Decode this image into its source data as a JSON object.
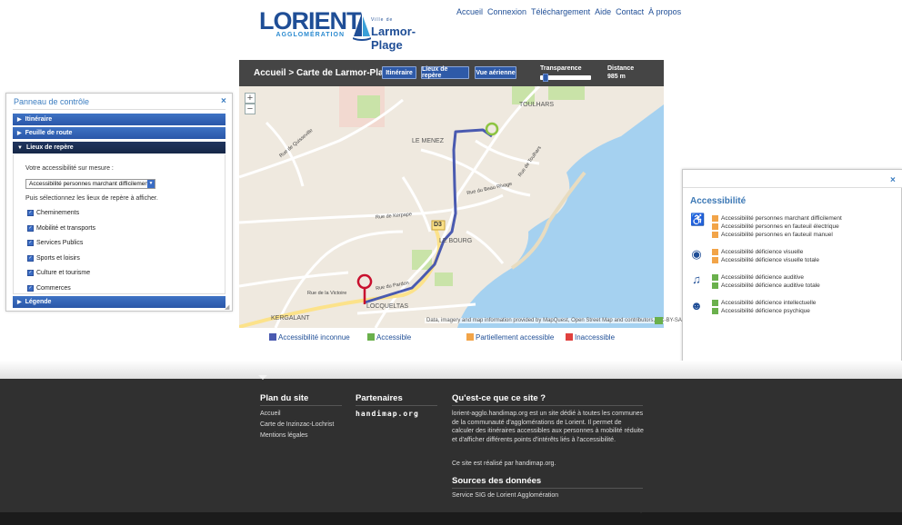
{
  "header": {
    "logo_lorient": {
      "word": "LORIENT",
      "sub": "AGGLOMÉRATION"
    },
    "logo_larmor": {
      "ville": "Ville de",
      "word": "Larmor-Plage"
    },
    "nav": [
      "Accueil",
      "Connexion",
      "Téléchargement",
      "Aide",
      "Contact",
      "À propos"
    ]
  },
  "toolbar": {
    "breadcrumb": "Accueil > Carte de Larmor-Plage",
    "buttons": [
      "Itinéraire",
      "Lieux de repère",
      "Vue aérienne"
    ],
    "transparence_label": "Transparence",
    "transparence_value": 0.05,
    "distance_label": "Distance",
    "distance_value": "985 m"
  },
  "map": {
    "zoom_in": "+",
    "zoom_out": "−",
    "labels": {
      "toulhars": "TOULHARS",
      "le_menez": "LE MENEZ",
      "le_bourg": "LE BOURG",
      "locqueltas": "LOCQUELTAS",
      "kergalant": "KERGALANT",
      "d3": "D3",
      "rue_kerpape": "Rue de Kerpape",
      "rue_beau_rivage": "Rue du Beau Rivage",
      "rue_quisseville": "Rue de Quisseville",
      "rue_victoire": "Rue de la Victoire",
      "rue_pardon": "Rue du Pardon",
      "rue_tourlhers": "Rue de Toulhars"
    },
    "attribution": "Data, imagery and map information provided by MapQuest, Open Street Map and contributors, CC-BY-SA"
  },
  "legend": [
    {
      "label": "Accessibilité inconnue",
      "color": "#4a5ab0"
    },
    {
      "label": "Accessible",
      "color": "#6ab04c"
    },
    {
      "label": "Partiellement accessible",
      "color": "#f2a448"
    },
    {
      "label": "Inaccessible",
      "color": "#e0413e"
    }
  ],
  "control_panel": {
    "title": "Panneau de contrôle",
    "close": "×",
    "sections": [
      "Itinéraire",
      "Feuille de route",
      "Lieux de repère",
      "Légende"
    ],
    "accessibility_label": "Votre accessibilité sur mesure :",
    "accessibility_selected": "Accessibilité personnes marchant difficilement",
    "instruction": "Puis sélectionnez les lieux de repère à afficher.",
    "checkboxes": [
      "Cheminements",
      "Mobilité et transports",
      "Services Publics",
      "Sports et loisirs",
      "Culture et tourisme",
      "Commerces"
    ],
    "check_mark": "✓",
    "arrow_right": "▶",
    "arrow_down": "▼",
    "select_arrow": "▼"
  },
  "accessibility_panel": {
    "title": "Accessibilité",
    "close": "×",
    "groups": [
      {
        "icon": "wheelchair-icon",
        "glyph": "♿",
        "items": [
          {
            "label": "Accessibilité personnes marchant difficilement",
            "color": "#f2a448"
          },
          {
            "label": "Accessibilité personnes en fauteuil électrique",
            "color": "#f2a448"
          },
          {
            "label": "Accessibilité personnes en fauteuil manuel",
            "color": "#f2a448"
          }
        ]
      },
      {
        "icon": "eye-icon",
        "glyph": "◉",
        "items": [
          {
            "label": "Accessibilité déficience visuelle",
            "color": "#f2a448"
          },
          {
            "label": "Accessibilité déficience visuelle totale",
            "color": "#f2a448"
          }
        ]
      },
      {
        "icon": "ear-icon",
        "glyph": "♫",
        "items": [
          {
            "label": "Accessibilité déficience auditive",
            "color": "#6ab04c"
          },
          {
            "label": "Accessibilité déficience auditive totale",
            "color": "#6ab04c"
          }
        ]
      },
      {
        "icon": "mind-icon",
        "glyph": "☻",
        "items": [
          {
            "label": "Accessibilité déficience intellectuelle",
            "color": "#6ab04c"
          },
          {
            "label": "Accessibilité déficience psychique",
            "color": "#6ab04c"
          }
        ]
      }
    ]
  },
  "footer": {
    "plan_title": "Plan du site",
    "plan_links": [
      "Accueil",
      "Carte de Inzinzac-Lochrist",
      "Mentions légales"
    ],
    "partners_title": "Partenaires",
    "partner_logo": "handimap.org",
    "about_title": "Qu'est-ce que ce site ?",
    "about_text": "lorient-agglo.handimap.org est un site dédié à toutes les communes de la communauté d'agglomérations de Lorient. Il permet de calculer des itinéraires accessibles aux personnes à mobilité réduite et d'afficher différents points d'intérêts liés à l'accessibilité.",
    "made_by": "Ce site est réalisé par handimap.org.",
    "sources_title": "Sources des données",
    "sources_text": "Service SIG de Lorient Agglomération"
  }
}
